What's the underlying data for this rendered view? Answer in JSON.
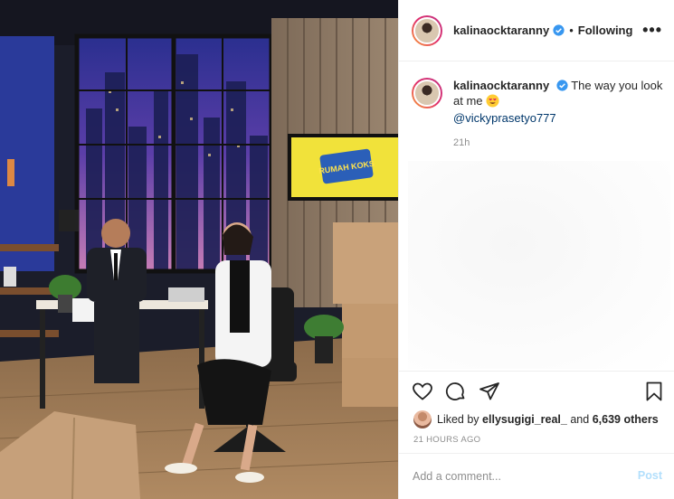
{
  "post": {
    "username": "kalinaocktaranny",
    "separator": "•",
    "follow_state": "Following",
    "more_glyph": "•••",
    "caption_text": "The way you look at me",
    "caption_mention": "@vickyprasetyo777",
    "caption_time": "21h",
    "liked_by_prefix": "Liked by",
    "liked_by_user": "ellysugigi_real_",
    "liked_by_and": "and",
    "likes_count": "6,639 others",
    "age_label": "21 HOURS AGO",
    "comment_placeholder": "Add a comment...",
    "post_label": "Post"
  },
  "photo": {
    "tv_text": "RUMAH KOKS"
  },
  "colors": {
    "verified": "#3897f0",
    "mention": "#00376b",
    "post_disabled": "#b2dffc",
    "muted": "#8e8e8e"
  },
  "icons": {
    "like": "heart-icon",
    "comment": "comment-icon",
    "share": "share-icon",
    "save": "bookmark-icon",
    "more": "more-options-icon",
    "verified": "verified-badge-icon",
    "emoji": "smiling-face-with-heart-eyes-emoji"
  }
}
